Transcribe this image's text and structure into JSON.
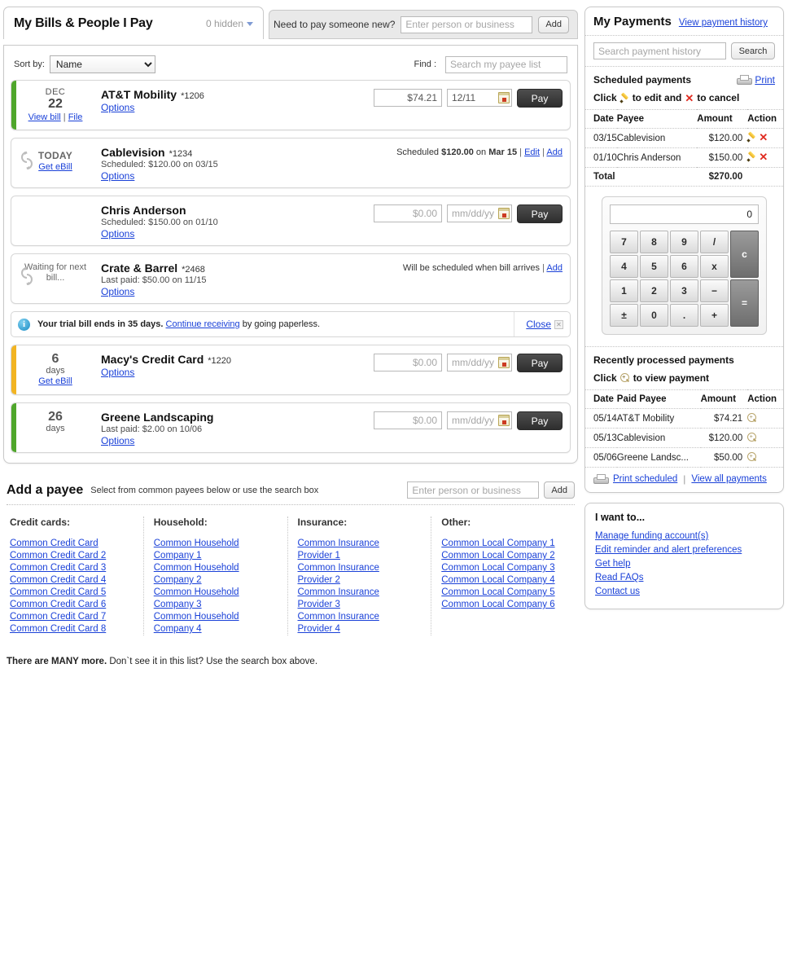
{
  "header": {
    "title": "My Bills & People I Pay",
    "hidden_label": "0 hidden",
    "new_payee_prompt": "Need to pay someone new?",
    "new_payee_placeholder": "Enter person or business",
    "new_payee_value": "",
    "add_label": "Add"
  },
  "controls": {
    "sort_label": "Sort by:",
    "sort_value": "Name",
    "sort_options": [
      "Name"
    ],
    "find_label": "Find :",
    "find_placeholder": "Search my payee list",
    "find_value": ""
  },
  "bills": [
    {
      "status_color": "green",
      "date_month": "DEC",
      "date_day": "22",
      "link1": "View bill",
      "link2": "File",
      "has_ebill_icon": false,
      "payee": "AT&T Mobility",
      "account": "*1206",
      "sub": "",
      "options_label": "Options",
      "amount_value": "$74.21",
      "amount_placeholder": "$0.00",
      "date_value": "12/11",
      "date_placeholder": "mm/dd/yy",
      "pay_label": "Pay",
      "note": ""
    },
    {
      "status_color": "none",
      "date_month": "",
      "date_today": "TODAY",
      "link1": "Get eBill",
      "link2": "",
      "has_ebill_icon": true,
      "payee": "Cablevision",
      "account": "*1234",
      "sub": "Scheduled: $120.00 on 03/15",
      "options_label": "Options",
      "note_prefix": "Scheduled ",
      "note_amount": "$120.00",
      "note_mid": " on ",
      "note_date": "Mar 15",
      "note_edit": "Edit",
      "note_add": "Add"
    },
    {
      "status_color": "none",
      "date_month": "",
      "date_day": "",
      "has_ebill_icon": false,
      "payee": "Chris Anderson",
      "account": "",
      "sub": "Scheduled: $150.00 on 01/10",
      "options_label": "Options",
      "amount_value": "",
      "amount_placeholder": "$0.00",
      "date_value": "",
      "date_placeholder": "mm/dd/yy",
      "pay_label": "Pay"
    },
    {
      "status_color": "none",
      "date_wait": "Waiting for next bill...",
      "has_ebill_icon": true,
      "payee": "Crate & Barrel",
      "account": "*2468",
      "sub": "Last paid: $50.00 on 11/15",
      "options_label": "Options",
      "note_text": "Will be scheduled when bill arrives",
      "note_add": "Add"
    },
    {
      "status_color": "yellow",
      "date_num": "6",
      "date_unit": "days",
      "link1": "Get eBill",
      "has_ebill_icon": false,
      "payee": "Macy's Credit Card",
      "account": "*1220",
      "sub": "",
      "options_label": "Options",
      "amount_value": "",
      "amount_placeholder": "$0.00",
      "date_value": "",
      "date_placeholder": "mm/dd/yy",
      "pay_label": "Pay"
    },
    {
      "status_color": "green",
      "date_num": "26",
      "date_unit": "days",
      "has_ebill_icon": false,
      "payee": "Greene Landscaping",
      "account": "",
      "sub": "Last paid: $2.00 on 10/06",
      "options_label": "Options",
      "amount_value": "",
      "amount_placeholder": "$0.00",
      "date_value": "",
      "date_placeholder": "mm/dd/yy",
      "pay_label": "Pay"
    }
  ],
  "notice": {
    "icon": "info-icon",
    "bold_text": "Your trial bill ends in 35 days.",
    "link_text": "Continue receiving",
    "tail_text": " by going paperless.",
    "close_label": "Close"
  },
  "add_payee": {
    "title": "Add a payee",
    "subtitle": "Select from common payees below or use the search box",
    "placeholder": "Enter person or business",
    "value": "",
    "add_label": "Add",
    "columns": [
      {
        "heading": "Credit cards:",
        "links": [
          "Common Credit Card",
          "Common Credit Card 2",
          "Common Credit Card 3",
          "Common Credit Card 4",
          "Common Credit Card 5",
          "Common Credit Card 6",
          "Common Credit Card 7",
          "Common Credit Card 8"
        ]
      },
      {
        "heading": "Household:",
        "links": [
          "Common Household",
          "Company 1",
          "Common Household",
          "Company 2",
          "Common Household",
          "Company 3",
          "Common Household",
          "Company 4"
        ]
      },
      {
        "heading": "Insurance:",
        "links": [
          "Common Insurance",
          "Provider 1",
          "Common Insurance",
          "Provider 2",
          "Common Insurance",
          "Provider 3",
          "Common Insurance",
          "Provider 4"
        ]
      },
      {
        "heading": "Other:",
        "links": [
          "Common Local Company 1",
          "Common Local Company 2",
          "Common Local Company 3",
          "Common Local Company 4",
          "Common Local Company 5",
          "Common Local Company 6"
        ]
      }
    ],
    "footer_bold": "There are MANY more.",
    "footer_rest": " Don`t see it in this list? Use the search box above."
  },
  "my_payments": {
    "title": "My Payments",
    "history_link": "View payment history",
    "search_placeholder": "Search payment history",
    "search_value": "",
    "search_button": "Search",
    "scheduled_title": "Scheduled payments",
    "print_label": "Print",
    "hint_pre": "Click",
    "hint_mid": "to edit and",
    "hint_post": "to cancel",
    "scheduled_headers": [
      "Date",
      "Payee",
      "Amount",
      "Action"
    ],
    "scheduled_rows": [
      {
        "date": "03/15",
        "payee": "Cablevision",
        "amount": "$120.00"
      },
      {
        "date": "01/10",
        "payee": "Chris Anderson",
        "amount": "$150.00"
      }
    ],
    "total_label": "Total",
    "total_amount": "$270.00",
    "calculator": {
      "display": "0",
      "keys": [
        "7",
        "8",
        "9",
        "/",
        "c",
        "4",
        "5",
        "6",
        "x",
        "1",
        "2",
        "3",
        "−",
        "=",
        "±",
        "0",
        ".",
        "+"
      ]
    },
    "recent_title": "Recently processed payments",
    "recent_hint_pre": "Click",
    "recent_hint_post": "to view payment",
    "recent_headers": [
      "Date",
      "Paid Payee",
      "Amount",
      "Action"
    ],
    "recent_rows": [
      {
        "date": "05/14",
        "payee": "AT&T Mobility",
        "amount": "$74.21"
      },
      {
        "date": "05/13",
        "payee": "Cablevision",
        "amount": "$120.00"
      },
      {
        "date": "05/06",
        "payee": "Greene Landsc...",
        "amount": "$50.00"
      }
    ],
    "print_scheduled": "Print scheduled",
    "view_all": "View all payments"
  },
  "i_want_to": {
    "title": "I want to...",
    "links": [
      "Manage funding account(s)",
      "Edit reminder and alert preferences",
      "Get help",
      "Read FAQs",
      "Contact us"
    ]
  },
  "colors": {
    "accent_link": "#1a41d8",
    "status_green": "#4fa62b",
    "status_yellow": "#f2b422",
    "pay_button": "#3a3a3a",
    "cancel_red": "#e02b20"
  }
}
